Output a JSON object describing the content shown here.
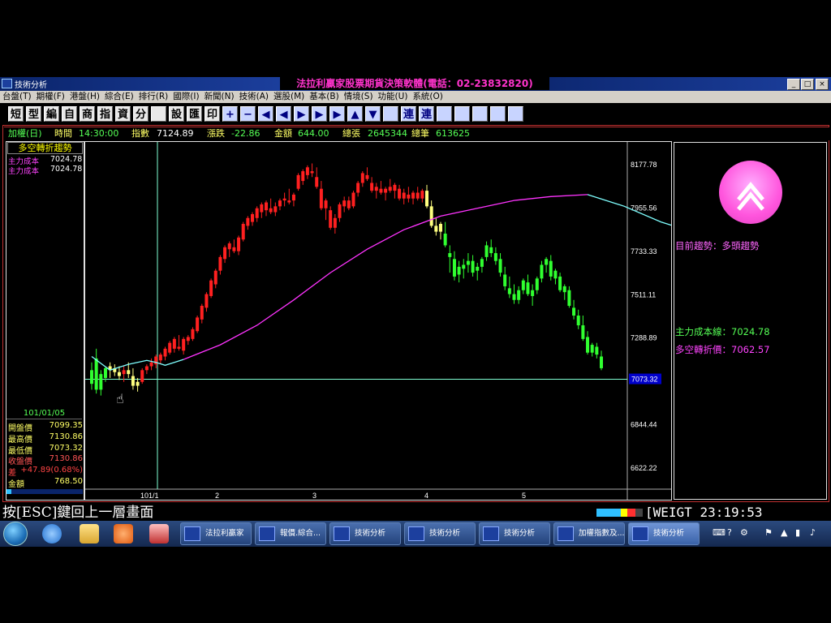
{
  "window": {
    "title": "技術分析",
    "banner": "法拉利贏家股票期貨決策軟體(電話：02-23832820)",
    "controls": [
      "_",
      "□",
      "×"
    ]
  },
  "menu": [
    "台盤(T)",
    "期權(F)",
    "港盤(H)",
    "綜合(E)",
    "排行(R)",
    "國際(I)",
    "新聞(N)",
    "技術(A)",
    "選股(M)",
    "基本(B)",
    "情境(S)",
    "功能(U)",
    "系統(O)"
  ],
  "toolbar": [
    "短",
    "型",
    "編",
    "自",
    "商",
    "指",
    "資",
    "分",
    "",
    "設",
    "匯",
    "印",
    "+",
    "−",
    "◀",
    "◀",
    "▶",
    "▶",
    "▶",
    "▲",
    "▼",
    "",
    "連",
    "連",
    "",
    "",
    "",
    "",
    ""
  ],
  "info": {
    "name": "加權(日)",
    "time_label": "時間",
    "time": "14:30:00",
    "index_label": "指數",
    "index": "7124.89",
    "change_label": "漲跌",
    "change": "-22.86",
    "amount_label": "金額",
    "amount": "644.00",
    "vol_label": "總張",
    "vol": "2645344",
    "trades_label": "總筆",
    "trades": "613625"
  },
  "left": {
    "header": "多空轉折趨勢",
    "cost1_label": "主力成本",
    "cost1": "7024.78",
    "cost2_label": "主力成本",
    "cost2": "7024.78",
    "date": "101/01/05",
    "rows": [
      {
        "label": "開盤價",
        "value": "7099.35"
      },
      {
        "label": "最高價",
        "value": "7130.86"
      },
      {
        "label": "最低價",
        "value": "7073.32"
      },
      {
        "label": "收盤價",
        "value": "7130.86"
      },
      {
        "label": "差",
        "value": "+47.89(0.68%)"
      },
      {
        "label": "金額",
        "value": "768.50"
      }
    ]
  },
  "right": {
    "trend_label": "目前趨勢：",
    "trend": "多頭趨勢",
    "cost_line_label": "主力成本線：",
    "cost_line": "7024.78",
    "turn_label": "多空轉折價：",
    "turn": "7062.57"
  },
  "chart_data": {
    "type": "candlestick",
    "y_ticks": [
      "8177.78",
      "7955.56",
      "7733.33",
      "7511.11",
      "7288.89",
      "7073.32",
      "6844.44",
      "6622.22"
    ],
    "ylim": [
      6510,
      8290
    ],
    "x_ticks": [
      "101/1",
      "2",
      "3",
      "4",
      "5"
    ],
    "crosshair_price": "7073.32",
    "candles": [
      [
        7050,
        7160,
        7020,
        7120,
        "g"
      ],
      [
        7180,
        7230,
        7000,
        7020,
        "g"
      ],
      [
        7020,
        7120,
        6990,
        7100,
        "g"
      ],
      [
        7080,
        7140,
        7060,
        7130,
        "g"
      ],
      [
        7120,
        7160,
        7080,
        7140,
        "y"
      ],
      [
        7130,
        7150,
        7090,
        7110,
        "y"
      ],
      [
        7110,
        7140,
        7070,
        7090,
        "y"
      ],
      [
        7100,
        7140,
        7060,
        7120,
        "r"
      ],
      [
        7120,
        7160,
        7080,
        7100,
        "y"
      ],
      [
        7090,
        7130,
        7020,
        7040,
        "y"
      ],
      [
        7040,
        7080,
        7010,
        7060,
        "y"
      ],
      [
        7060,
        7130,
        7050,
        7120,
        "r"
      ],
      [
        7120,
        7150,
        7100,
        7140,
        "r"
      ],
      [
        7140,
        7180,
        7120,
        7160,
        "r"
      ],
      [
        7150,
        7200,
        7130,
        7190,
        "r"
      ],
      [
        7170,
        7210,
        7150,
        7200,
        "r"
      ],
      [
        7190,
        7240,
        7170,
        7230,
        "r"
      ],
      [
        7210,
        7270,
        7200,
        7260,
        "r"
      ],
      [
        7230,
        7290,
        7210,
        7280,
        "r"
      ],
      [
        7240,
        7300,
        7220,
        7230,
        "r"
      ],
      [
        7220,
        7290,
        7200,
        7280,
        "r"
      ],
      [
        7270,
        7300,
        7250,
        7290,
        "r"
      ],
      [
        7280,
        7340,
        7270,
        7330,
        "r"
      ],
      [
        7320,
        7400,
        7310,
        7390,
        "r"
      ],
      [
        7380,
        7460,
        7360,
        7450,
        "r"
      ],
      [
        7440,
        7520,
        7420,
        7510,
        "r"
      ],
      [
        7500,
        7590,
        7490,
        7580,
        "r"
      ],
      [
        7560,
        7640,
        7540,
        7630,
        "r"
      ],
      [
        7630,
        7710,
        7610,
        7700,
        "r"
      ],
      [
        7690,
        7760,
        7670,
        7750,
        "r"
      ],
      [
        7740,
        7780,
        7700,
        7770,
        "r"
      ],
      [
        7750,
        7790,
        7720,
        7730,
        "r"
      ],
      [
        7730,
        7810,
        7710,
        7800,
        "r"
      ],
      [
        7790,
        7880,
        7780,
        7870,
        "r"
      ],
      [
        7860,
        7910,
        7840,
        7900,
        "r"
      ],
      [
        7880,
        7930,
        7860,
        7920,
        "r"
      ],
      [
        7900,
        7960,
        7880,
        7950,
        "r"
      ],
      [
        7930,
        7980,
        7900,
        7970,
        "r"
      ],
      [
        7940,
        7990,
        7910,
        7980,
        "r"
      ],
      [
        7950,
        8000,
        7920,
        7930,
        "r"
      ],
      [
        7930,
        7980,
        7910,
        7960,
        "r"
      ],
      [
        7960,
        8000,
        7940,
        7990,
        "r"
      ],
      [
        7990,
        8030,
        7960,
        8000,
        "r"
      ],
      [
        7980,
        8050,
        7970,
        7990,
        "r"
      ],
      [
        7990,
        8030,
        7960,
        8020,
        "r"
      ],
      [
        8050,
        8130,
        8040,
        8120,
        "r"
      ],
      [
        8090,
        8150,
        8070,
        8140,
        "r"
      ],
      [
        8120,
        8170,
        8100,
        8160,
        "r"
      ],
      [
        8130,
        8180,
        8110,
        8140,
        "r"
      ],
      [
        8110,
        8160,
        8050,
        8060,
        "r"
      ],
      [
        8050,
        8090,
        7940,
        7950,
        "r"
      ],
      [
        7950,
        8000,
        7890,
        7990,
        "r"
      ],
      [
        7940,
        7960,
        7840,
        7850,
        "r"
      ],
      [
        7850,
        7920,
        7820,
        7900,
        "r"
      ],
      [
        7900,
        7980,
        7880,
        7970,
        "r"
      ],
      [
        7960,
        8010,
        7930,
        7990,
        "r"
      ],
      [
        7990,
        8010,
        7940,
        7950,
        "r"
      ],
      [
        7960,
        8040,
        7950,
        8030,
        "r"
      ],
      [
        8030,
        8090,
        8010,
        8080,
        "r"
      ],
      [
        8080,
        8140,
        8060,
        8130,
        "r"
      ],
      [
        8120,
        8160,
        8090,
        8100,
        "r"
      ],
      [
        8080,
        8110,
        8030,
        8040,
        "r"
      ],
      [
        8040,
        8080,
        8000,
        8060,
        "r"
      ],
      [
        8050,
        8090,
        8020,
        8030,
        "r"
      ],
      [
        8030,
        8060,
        7990,
        8050,
        "r"
      ],
      [
        8060,
        8100,
        8030,
        8040,
        "r"
      ],
      [
        8040,
        8080,
        8000,
        8070,
        "r"
      ],
      [
        8050,
        8070,
        7990,
        8000,
        "r"
      ],
      [
        8000,
        8050,
        7970,
        8030,
        "r"
      ],
      [
        8020,
        8060,
        7980,
        8000,
        "r"
      ],
      [
        8000,
        8040,
        7970,
        8030,
        "r"
      ],
      [
        8030,
        8060,
        7990,
        8000,
        "r"
      ],
      [
        8000,
        8050,
        7980,
        8040,
        "r"
      ],
      [
        8040,
        8070,
        7950,
        7960,
        "y"
      ],
      [
        7960,
        7990,
        7850,
        7860,
        "y"
      ],
      [
        7860,
        7900,
        7810,
        7830,
        "y"
      ],
      [
        7830,
        7880,
        7790,
        7870,
        "y"
      ],
      [
        7820,
        7880,
        7750,
        7760,
        "g"
      ],
      [
        7700,
        7760,
        7620,
        7720,
        "g"
      ],
      [
        7690,
        7730,
        7580,
        7600,
        "g"
      ],
      [
        7610,
        7680,
        7570,
        7650,
        "g"
      ],
      [
        7640,
        7690,
        7590,
        7660,
        "g"
      ],
      [
        7660,
        7720,
        7620,
        7680,
        "g"
      ],
      [
        7680,
        7710,
        7600,
        7620,
        "g"
      ],
      [
        7630,
        7670,
        7580,
        7650,
        "g"
      ],
      [
        7650,
        7700,
        7620,
        7690,
        "g"
      ],
      [
        7700,
        7780,
        7680,
        7760,
        "g"
      ],
      [
        7750,
        7790,
        7700,
        7720,
        "g"
      ],
      [
        7720,
        7750,
        7660,
        7680,
        "g"
      ],
      [
        7690,
        7720,
        7600,
        7620,
        "g"
      ],
      [
        7610,
        7650,
        7530,
        7550,
        "g"
      ],
      [
        7540,
        7600,
        7490,
        7510,
        "g"
      ],
      [
        7510,
        7560,
        7460,
        7480,
        "g"
      ],
      [
        7480,
        7550,
        7460,
        7530,
        "g"
      ],
      [
        7530,
        7590,
        7510,
        7580,
        "g"
      ],
      [
        7570,
        7610,
        7500,
        7510,
        "g"
      ],
      [
        7500,
        7560,
        7450,
        7530,
        "g"
      ],
      [
        7530,
        7600,
        7510,
        7590,
        "g"
      ],
      [
        7590,
        7680,
        7570,
        7660,
        "g"
      ],
      [
        7660,
        7700,
        7620,
        7690,
        "g"
      ],
      [
        7680,
        7710,
        7580,
        7600,
        "g"
      ],
      [
        7590,
        7640,
        7560,
        7630,
        "g"
      ],
      [
        7600,
        7620,
        7520,
        7530,
        "g"
      ],
      [
        7520,
        7560,
        7480,
        7550,
        "g"
      ],
      [
        7530,
        7550,
        7440,
        7450,
        "g"
      ],
      [
        7440,
        7480,
        7380,
        7400,
        "g"
      ],
      [
        7400,
        7430,
        7330,
        7350,
        "g"
      ],
      [
        7350,
        7400,
        7270,
        7280,
        "g"
      ],
      [
        7290,
        7320,
        7200,
        7210,
        "g"
      ],
      [
        7210,
        7260,
        7190,
        7250,
        "g"
      ],
      [
        7240,
        7260,
        7180,
        7200,
        "g"
      ],
      [
        7190,
        7220,
        7120,
        7130,
        "g"
      ]
    ],
    "cyan_ma": [
      [
        0,
        7190
      ],
      [
        4,
        7120
      ],
      [
        8,
        7150
      ],
      [
        12,
        7170
      ],
      [
        14,
        7160
      ],
      [
        16,
        7145
      ],
      [
        18,
        7160
      ],
      [
        20,
        7175
      ]
    ],
    "magenta_ma": [
      [
        20,
        7175
      ],
      [
        28,
        7250
      ],
      [
        36,
        7350
      ],
      [
        44,
        7480
      ],
      [
        52,
        7620
      ],
      [
        60,
        7740
      ],
      [
        68,
        7840
      ],
      [
        76,
        7910
      ],
      [
        84,
        7950
      ],
      [
        92,
        7990
      ],
      [
        100,
        8010
      ],
      [
        108,
        8020
      ]
    ],
    "cyan_ma2": [
      [
        108,
        8020
      ],
      [
        116,
        7960
      ],
      [
        124,
        7880
      ],
      [
        132,
        7820
      ],
      [
        140,
        7760
      ],
      [
        148,
        7700
      ],
      [
        156,
        7660
      ],
      [
        164,
        7610
      ],
      [
        172,
        7550
      ],
      [
        180,
        7470
      ],
      [
        186,
        7400
      ]
    ]
  },
  "status": {
    "esc_msg": "按[ESC]鍵回上一層畫面",
    "ticker": "[WEIGT",
    "clock": "23:19:53"
  },
  "taskbar": {
    "tasks": [
      "法拉利贏家",
      "報價.綜合...",
      "技術分析",
      "技術分析",
      "技術分析",
      "加權指數及...",
      "技術分析"
    ]
  }
}
